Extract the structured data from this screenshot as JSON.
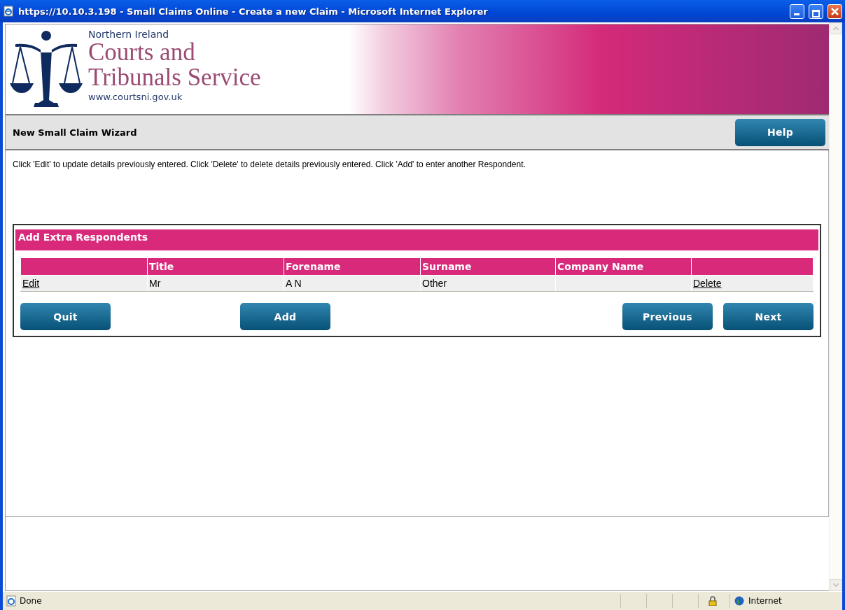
{
  "window": {
    "title": "https://10.10.3.198 - Small Claims Online - Create a new Claim - Microsoft Internet Explorer"
  },
  "header": {
    "region": "Northern Ireland",
    "name_line1": "Courts and",
    "name_line2": "Tribunals Service",
    "url": "www.courtsni.gov.uk"
  },
  "wizard": {
    "title": "New Small Claim Wizard",
    "help_button": "Help"
  },
  "instructions": "Click 'Edit' to update details previously entered. Click 'Delete' to delete details previously entered. Click 'Add' to enter another Respondent.",
  "panel": {
    "title": "Add Extra Respondents",
    "columns": [
      "Title",
      "Forename",
      "Surname",
      "Company Name"
    ],
    "rows": [
      {
        "edit_link": "Edit",
        "cells": [
          "Mr",
          "A N",
          "Other",
          null
        ],
        "delete_link": "Delete"
      }
    ],
    "left_buttons": [
      "Quit",
      "Add"
    ],
    "right_buttons": [
      "Previous",
      "Next"
    ]
  },
  "status_bar": {
    "text": "Done",
    "zone": "Internet"
  }
}
